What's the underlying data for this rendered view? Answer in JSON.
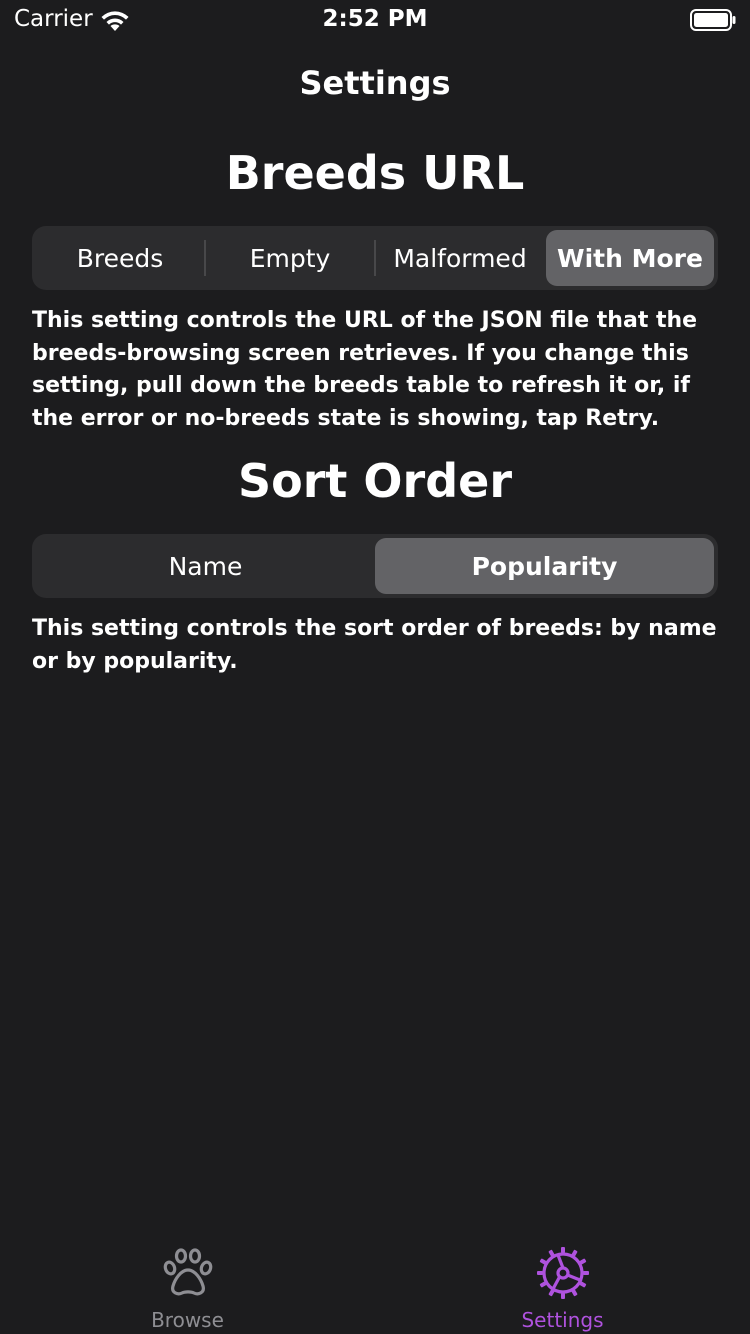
{
  "status_bar": {
    "carrier": "Carrier",
    "time": "2:52 PM",
    "wifi_icon": "wifi-icon",
    "battery_icon": "battery-icon"
  },
  "nav": {
    "title": "Settings"
  },
  "breeds_url": {
    "title": "Breeds URL",
    "options": [
      "Breeds",
      "Empty",
      "Malformed",
      "With More"
    ],
    "selected": "With More",
    "description": "This setting controls the URL of the JSON file that the breeds-browsing screen retrieves. If you change this setting, pull down the breeds table to refresh it or, if the error or no-breeds state is showing, tap Retry."
  },
  "sort_order": {
    "title": "Sort Order",
    "options": [
      "Name",
      "Popularity"
    ],
    "selected": "Popularity",
    "description": "This setting controls the sort order of breeds: by name or by popularity."
  },
  "tab_bar": {
    "tabs": [
      {
        "label": "Browse",
        "icon": "paw-icon",
        "active": false
      },
      {
        "label": "Settings",
        "icon": "settings-gear-icon",
        "active": true
      }
    ]
  },
  "colors": {
    "background": "#1c1c1e",
    "segment_bg": "#2c2c2e",
    "segment_selected": "#636366",
    "accent": "#af52de",
    "inactive_tab": "#8e8e93"
  }
}
